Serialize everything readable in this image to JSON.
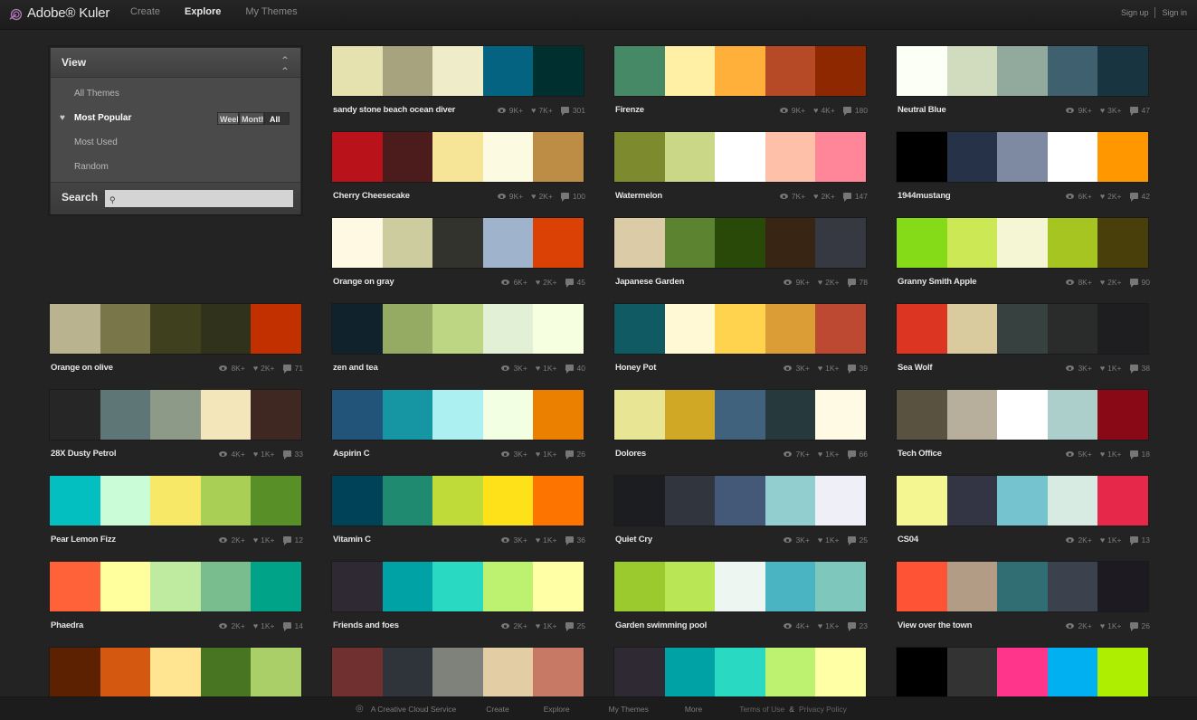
{
  "header": {
    "app_title": "Adobe® Kuler",
    "nav": [
      {
        "label": "Create",
        "active": false
      },
      {
        "label": "Explore",
        "active": true
      },
      {
        "label": "My Themes",
        "active": false
      }
    ],
    "sign_up": "Sign up",
    "sign_in": "Sign in"
  },
  "view_panel": {
    "title": "View",
    "items": [
      {
        "label": "All Themes",
        "active": false
      },
      {
        "label": "Most Popular",
        "active": true
      },
      {
        "label": "Most Used",
        "active": false
      },
      {
        "label": "Random",
        "active": false
      }
    ],
    "period_options": [
      "Week",
      "Month",
      "All"
    ],
    "period_selected": "All",
    "search_label": "Search",
    "search_value": "",
    "search_placeholder": ""
  },
  "themes": [
    {
      "name": "sandy stone beach ocean diver",
      "views": "9K+",
      "likes": "7K+",
      "comments": "301",
      "colors": [
        "#E6E2AF",
        "#A7A37E",
        "#EFECCA",
        "#046380",
        "#002F2F"
      ]
    },
    {
      "name": "Firenze",
      "views": "9K+",
      "likes": "4K+",
      "comments": "180",
      "colors": [
        "#468966",
        "#FFF0A5",
        "#FFB03B",
        "#B64926",
        "#8E2800"
      ]
    },
    {
      "name": "Neutral Blue",
      "views": "9K+",
      "likes": "3K+",
      "comments": "47",
      "colors": [
        "#FCFFF5",
        "#D1DBBD",
        "#91AA9D",
        "#3E606F",
        "#193441"
      ]
    },
    {
      "name": "Cherry Cheesecake",
      "views": "9K+",
      "likes": "2K+",
      "comments": "100",
      "colors": [
        "#B9121B",
        "#4C1B1B",
        "#F6E497",
        "#FCFAE1",
        "#BD8D46"
      ]
    },
    {
      "name": "Watermelon",
      "views": "7K+",
      "likes": "2K+",
      "comments": "147",
      "colors": [
        "#7D8A2E",
        "#C9D787",
        "#FFFFFF",
        "#FFC0A9",
        "#FF8598"
      ]
    },
    {
      "name": "1944mustang",
      "views": "6K+",
      "likes": "2K+",
      "comments": "42",
      "colors": [
        "#000000",
        "#263248",
        "#7E8AA2",
        "#FFFFFF",
        "#FF9800"
      ]
    },
    {
      "name": "Orange on gray",
      "views": "6K+",
      "likes": "2K+",
      "comments": "45",
      "colors": [
        "#FFF8E3",
        "#CCCC9F",
        "#33332D",
        "#9FB4CC",
        "#DB4105"
      ]
    },
    {
      "name": "Japanese Garden",
      "views": "9K+",
      "likes": "2K+",
      "comments": "78",
      "colors": [
        "#DBCBA7",
        "#5C832F",
        "#284907",
        "#382513",
        "#363942"
      ]
    },
    {
      "name": "Granny Smith Apple",
      "views": "8K+",
      "likes": "2K+",
      "comments": "90",
      "colors": [
        "#85DB18",
        "#CDE855",
        "#F5F6D4",
        "#A7C520",
        "#493F0B"
      ]
    },
    {
      "name": "Orange on olive",
      "views": "8K+",
      "likes": "2K+",
      "comments": "71",
      "colors": [
        "#B9B48F",
        "#79774A",
        "#3F401E",
        "#31321B",
        "#C23000"
      ]
    },
    {
      "name": "zen and tea",
      "views": "3K+",
      "likes": "1K+",
      "comments": "40",
      "colors": [
        "#10222B",
        "#95AB63",
        "#BDD684",
        "#E2F0D6",
        "#F6FFE0"
      ]
    },
    {
      "name": "Honey Pot",
      "views": "3K+",
      "likes": "1K+",
      "comments": "39",
      "colors": [
        "#105B63",
        "#FFFAD5",
        "#FFD34E",
        "#DB9E36",
        "#BD4932"
      ]
    },
    {
      "name": "Sea Wolf",
      "views": "3K+",
      "likes": "1K+",
      "comments": "38",
      "colors": [
        "#DC3522",
        "#D9CB9E",
        "#374140",
        "#2A2C2B",
        "#1E1E20"
      ]
    },
    {
      "name": "28X Dusty Petrol",
      "views": "4K+",
      "likes": "1K+",
      "comments": "33",
      "colors": [
        "#262626",
        "#5E7675",
        "#8D9A88",
        "#F2E6BA",
        "#3F2822"
      ]
    },
    {
      "name": "Aspirin C",
      "views": "3K+",
      "likes": "1K+",
      "comments": "26",
      "colors": [
        "#225378",
        "#1695A3",
        "#ACF0F2",
        "#F3FFE2",
        "#EB7F00"
      ]
    },
    {
      "name": "Dolores",
      "views": "7K+",
      "likes": "1K+",
      "comments": "66",
      "colors": [
        "#E8E595",
        "#D0A825",
        "#40627C",
        "#26393D",
        "#FFFAE4"
      ]
    },
    {
      "name": "Tech Office",
      "views": "5K+",
      "likes": "1K+",
      "comments": "18",
      "colors": [
        "#595241",
        "#B8AE9C",
        "#FFFFFF",
        "#ACCFCC",
        "#8A0917"
      ]
    },
    {
      "name": "Pear Lemon Fizz",
      "views": "2K+",
      "likes": "1K+",
      "comments": "12",
      "colors": [
        "#04BFBF",
        "#CAFCD8",
        "#F7E967",
        "#A9CF54",
        "#588F27"
      ]
    },
    {
      "name": "Vitamin C",
      "views": "3K+",
      "likes": "1K+",
      "comments": "36",
      "colors": [
        "#004358",
        "#1F8A70",
        "#BEDB39",
        "#FFE11A",
        "#FD7400"
      ]
    },
    {
      "name": "Quiet Cry",
      "views": "3K+",
      "likes": "1K+",
      "comments": "25",
      "colors": [
        "#1C1D21",
        "#31353D",
        "#445878",
        "#92CDCF",
        "#EEEFF7"
      ]
    },
    {
      "name": "CS04",
      "views": "2K+",
      "likes": "1K+",
      "comments": "13",
      "colors": [
        "#F4F692",
        "#333545",
        "#76C3D0",
        "#D8EBE3",
        "#E6294B"
      ]
    },
    {
      "name": "Phaedra",
      "views": "2K+",
      "likes": "1K+",
      "comments": "14",
      "colors": [
        "#FF6138",
        "#FFFF9D",
        "#BEEB9F",
        "#79BD8F",
        "#00A388"
      ]
    },
    {
      "name": "Friends and foes",
      "views": "2K+",
      "likes": "1K+",
      "comments": "25",
      "colors": [
        "#2F2933",
        "#01A2A6",
        "#29D9C2",
        "#BDF271",
        "#FFFFA6"
      ]
    },
    {
      "name": "Garden swimming pool",
      "views": "4K+",
      "likes": "1K+",
      "comments": "23",
      "colors": [
        "#9BCA2F",
        "#B8E655",
        "#EEF6F1",
        "#4BB4C2",
        "#7EC7BD"
      ]
    },
    {
      "name": "View over the town",
      "views": "2K+",
      "likes": "1K+",
      "comments": "26",
      "colors": [
        "#FF5335",
        "#B39C85",
        "#306E73",
        "#3B414D",
        "#1D1A22"
      ]
    },
    {
      "name": "",
      "views": "",
      "likes": "",
      "comments": "",
      "colors": [
        "#5C2100",
        "#D4580F",
        "#FFE491",
        "#477522",
        "#ABCF68"
      ]
    },
    {
      "name": "",
      "views": "",
      "likes": "",
      "comments": "",
      "colors": [
        "#703030",
        "#2F343B",
        "#7E827A",
        "#E3CDA4",
        "#C77966"
      ]
    },
    {
      "name": "",
      "views": "",
      "likes": "",
      "comments": "",
      "colors": [
        "#2F2933",
        "#01A2A6",
        "#29D9C2",
        "#BDF271",
        "#FFFFA6"
      ]
    },
    {
      "name": "",
      "views": "",
      "likes": "",
      "comments": "",
      "colors": [
        "#000000",
        "#333333",
        "#FF358B",
        "#01B0F0",
        "#AEEE00"
      ]
    }
  ],
  "footer": {
    "service": "A Creative Cloud Service",
    "links": [
      "Create",
      "Explore",
      "My Themes",
      "More"
    ],
    "terms": "Terms of Use",
    "amp": "&",
    "privacy": "Privacy Policy"
  }
}
